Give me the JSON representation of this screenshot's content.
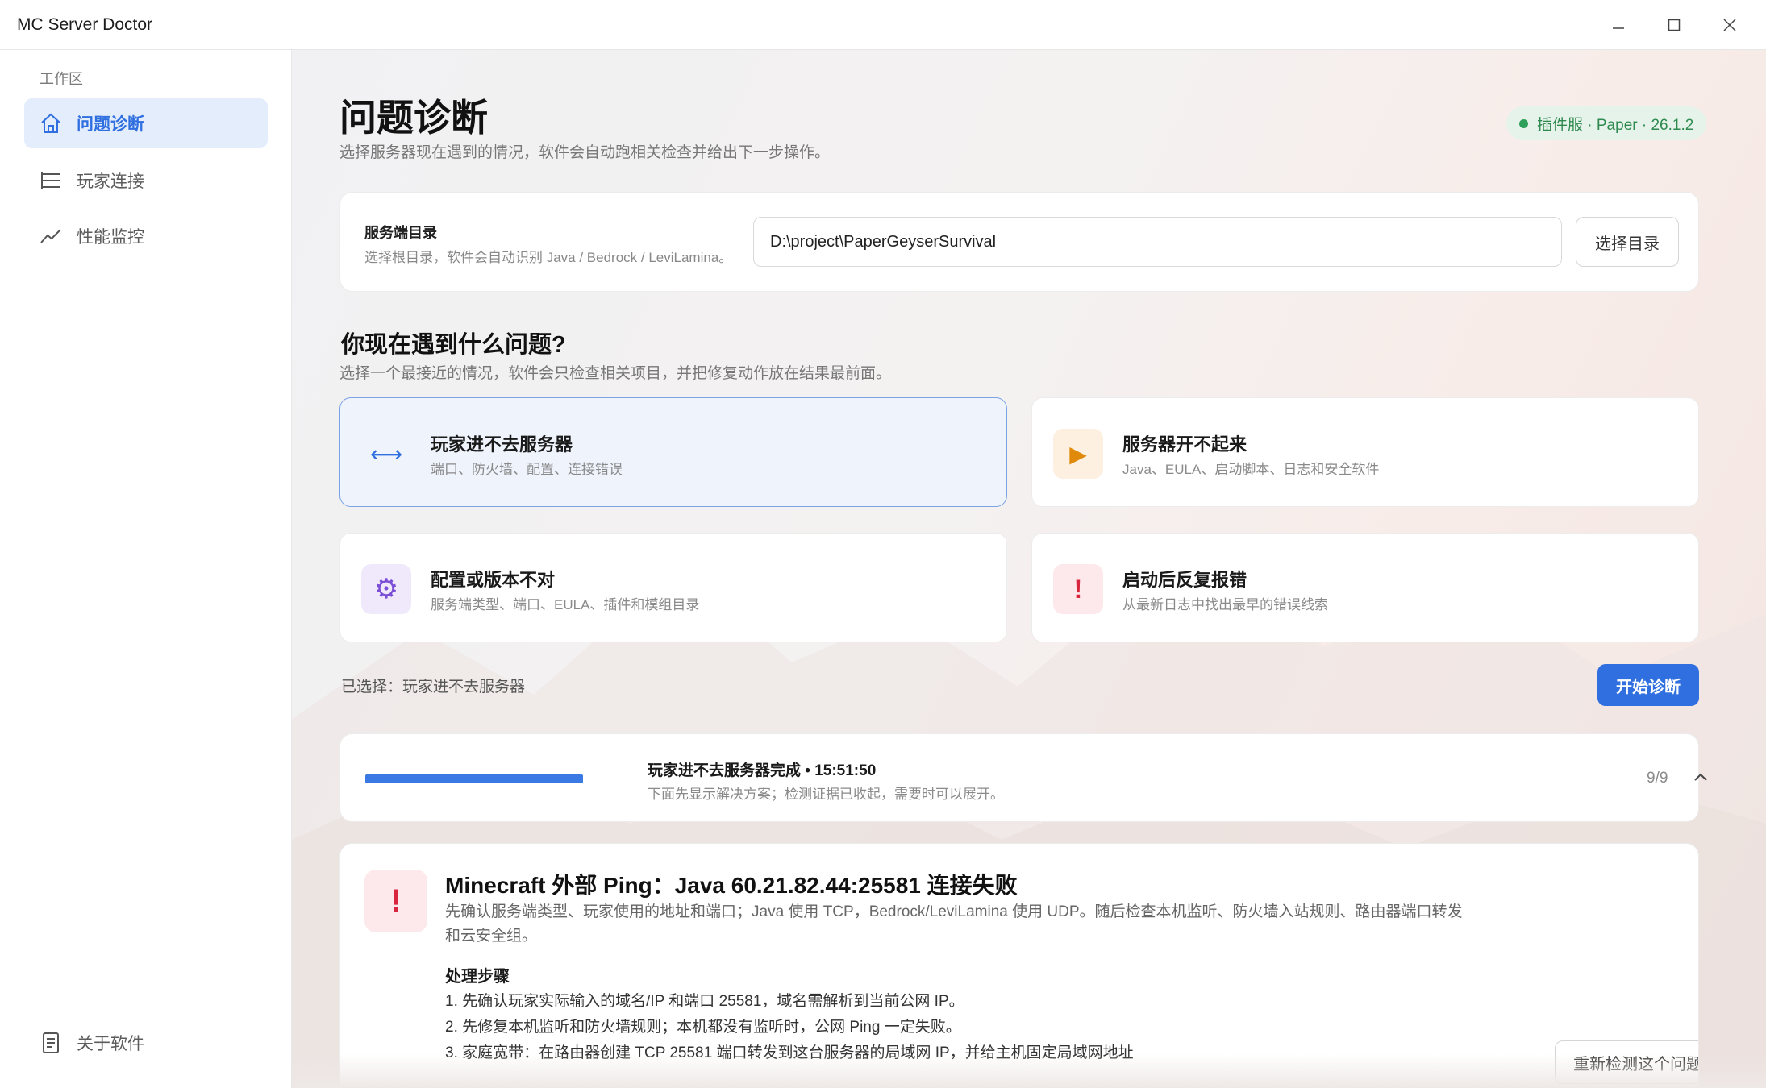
{
  "window": {
    "title": "MC Server Doctor",
    "controls": [
      "minimize-icon",
      "maximize-icon",
      "close-icon"
    ]
  },
  "sidebar": {
    "section_label": "工作区",
    "items": [
      {
        "label": "问题诊断",
        "icon": "home-icon",
        "active": true
      },
      {
        "label": "玩家连接",
        "icon": "list-icon",
        "active": false
      },
      {
        "label": "性能监控",
        "icon": "trend-icon",
        "active": false
      }
    ],
    "footer_item": {
      "label": "关于软件",
      "icon": "document-icon"
    }
  },
  "header": {
    "title": "问题诊断",
    "subtitle": "选择服务器现在遇到的情况，软件会自动跑相关检查并给出下一步操作。",
    "server_badge": "插件服 · Paper · 26.1.2"
  },
  "server_dir": {
    "label": "服务端目录",
    "hint": "选择根目录，软件会自动识别 Java / Bedrock / LeviLamina。",
    "value": "D:\\project\\PaperGeyserSurvival",
    "button": "选择目录"
  },
  "problems": {
    "title": "你现在遇到什么问题?",
    "subtitle": "选择一个最接近的情况，软件会只检查相关项目，并把修复动作放在结果最前面。",
    "items": [
      {
        "title": "玩家进不去服务器",
        "desc": "端口、防火墙、配置、连接错误",
        "icon": "arrows-icon",
        "glyph": "⟷",
        "selected": true
      },
      {
        "title": "服务器开不起来",
        "desc": "Java、EULA、启动脚本、日志和安全软件",
        "icon": "play-icon",
        "glyph": "▶",
        "selected": false
      },
      {
        "title": "配置或版本不对",
        "desc": "服务端类型、端口、EULA、插件和模组目录",
        "icon": "gear-icon",
        "glyph": "⚙",
        "selected": false
      },
      {
        "title": "启动后反复报错",
        "desc": "从最新日志中找出最早的错误线索",
        "icon": "alert-icon",
        "glyph": "!",
        "selected": false
      }
    ]
  },
  "selection": {
    "text": "已选择：玩家进不去服务器",
    "start_button": "开始诊断"
  },
  "progress": {
    "title": "玩家进不去服务器完成 • 15:51:50",
    "desc": "下面先显示解决方案；检测证据已收起，需要时可以展开。",
    "count": "9/9",
    "fraction": 1.0
  },
  "issue": {
    "title": "Minecraft 外部 Ping：Java 60.21.82.44:25581 连接失败",
    "desc": "先确认服务端类型、玩家使用的地址和端口；Java 使用 TCP，Bedrock/LeviLamina 使用 UDP。随后检查本机监听、防火墙入站规则、路由器端口转发和云安全组。",
    "steps_title": "处理步骤",
    "steps": [
      "1. 先确认玩家实际输入的域名/IP 和端口 25581，域名需解析到当前公网 IP。",
      "2. 先修复本机监听和防火墙规则；本机都没有监听时，公网 Ping 一定失败。",
      "3. 家庭宽带：在路由器创建 TCP 25581 端口转发到这台服务器的局域网 IP，并给主机固定局域网地址"
    ],
    "recheck_button": "重新检测这个问题"
  },
  "colors": {
    "accent": "#2f6fe0",
    "success": "#2ea05a",
    "danger": "#d7263d",
    "warning": "#e08a0b",
    "purple": "#7a4fd6"
  }
}
